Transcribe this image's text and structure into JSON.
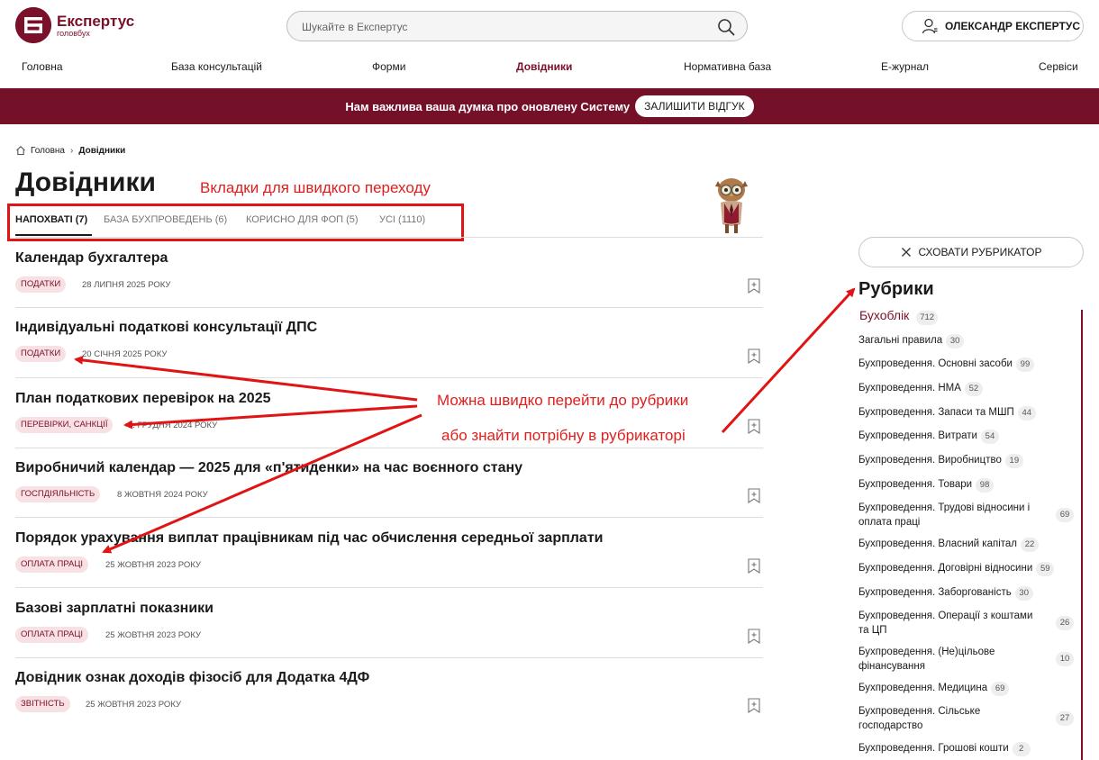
{
  "header": {
    "logo_title": "Експертус",
    "logo_sub": "головбух",
    "search_placeholder": "Шукайте в Експертус",
    "user_label": "ОЛЕКСАНДР ЕКСПЕРТУС"
  },
  "nav": {
    "items": [
      "Головна",
      "База консультацій",
      "Форми",
      "Довідники",
      "Нормативна база",
      "Е-журнал",
      "Сервіси"
    ],
    "active": "Довідники"
  },
  "banner": {
    "text": "Нам важлива ваша думка про оновлену Систему",
    "button": "ЗАЛИШИТИ ВІДГУК"
  },
  "breadcrumb": {
    "home": "Головна",
    "current": "Довідники"
  },
  "page": {
    "title": "Довідники"
  },
  "tabs": [
    {
      "label": "НАПОХВАТІ (7)",
      "active": true
    },
    {
      "label": "БАЗА БУХПРОВЕДЕНЬ (6)",
      "active": false
    },
    {
      "label": "КОРИСНО ДЛЯ ФОП (5)",
      "active": false
    },
    {
      "label": "УСІ (1110)",
      "active": false
    }
  ],
  "articles": [
    {
      "title": "Календар бухгалтера",
      "tag": "ПОДАТКИ",
      "date": "28 ЛИПНЯ 2025 РОКУ"
    },
    {
      "title": "Індивідуальні податкові консультації ДПС",
      "tag": "ПОДАТКИ",
      "date": "20 СІЧНЯ 2025 РОКУ"
    },
    {
      "title": "План податкових перевірок на 2025",
      "tag": "ПЕРЕВІРКИ, САНКЦІЇ",
      "date": "... ГРУДНЯ 2024 РОКУ"
    },
    {
      "title": "Виробничий календар — 2025 для «п'ятиденки» на час воєнного стану",
      "tag": "ГОСПДІЯЛЬНІСТЬ",
      "date": "8 ЖОВТНЯ 2024 РОКУ"
    },
    {
      "title": "Порядок урахування виплат працівникам під час обчислення середньої зарплати",
      "tag": "ОПЛАТА ПРАЦІ",
      "date": "25 ЖОВТНЯ 2023 РОКУ"
    },
    {
      "title": "Базові зарплатні показники",
      "tag": "ОПЛАТА ПРАЦІ",
      "date": "25 ЖОВТНЯ 2023 РОКУ"
    },
    {
      "title": "Довідник ознак доходів фізосіб для Додатка 4ДФ",
      "tag": "ЗВІТНІСТЬ",
      "date": "25 ЖОВТНЯ 2023 РОКУ"
    }
  ],
  "sidebar": {
    "hide_button": "СХОВАТИ РУБРИКАТОР",
    "title": "Рубрики",
    "top_rubric": {
      "name": "Бухоблік",
      "count": "712"
    },
    "rubrics": [
      {
        "name": "Загальні правила",
        "count": "30"
      },
      {
        "name": "Бухпроведення. Основні засоби",
        "count": "99"
      },
      {
        "name": "Бухпроведення. НМА",
        "count": "52"
      },
      {
        "name": "Бухпроведення. Запаси та МШП",
        "count": "44"
      },
      {
        "name": "Бухпроведення. Витрати",
        "count": "54"
      },
      {
        "name": "Бухпроведення. Виробництво",
        "count": "19"
      },
      {
        "name": "Бухпроведення. Товари",
        "count": "98"
      },
      {
        "name": "Бухпроведення. Трудові відносини і оплата праці",
        "count": "69"
      },
      {
        "name": "Бухпроведення. Власний капітал",
        "count": "22"
      },
      {
        "name": "Бухпроведення. Договірні відносини",
        "count": "59"
      },
      {
        "name": "Бухпроведення. Заборгованість",
        "count": "30"
      },
      {
        "name": "Бухпроведення. Операції з коштами та ЦП",
        "count": "26"
      },
      {
        "name": "Бухпроведення. (Не)цільове фінансування",
        "count": "10"
      },
      {
        "name": "Бухпроведення. Медицина",
        "count": "69"
      },
      {
        "name": "Бухпроведення. Сільське господарство",
        "count": "27"
      },
      {
        "name": "Бухпроведення. Грошові кошти",
        "count": "2"
      }
    ]
  },
  "annotations": {
    "tabs_note": "Вкладки для швидкого переходу",
    "rubric_note_1": "Можна швидко перейти до рубрики",
    "rubric_note_2": "або знайти потрібну в рубрикаторі"
  },
  "colors": {
    "brand": "#7a1029",
    "banner": "#741028",
    "annotation": "#e01e1e",
    "tag_bg": "#f8e1e4"
  }
}
